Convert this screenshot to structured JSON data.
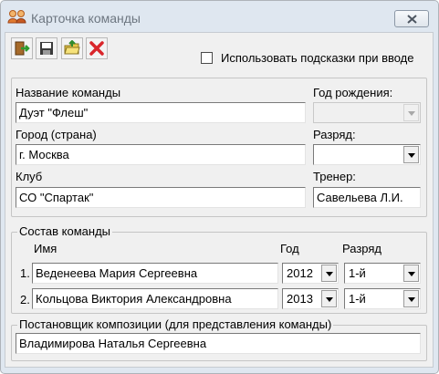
{
  "window": {
    "title": "Карточка команды"
  },
  "toolbar": {
    "buttons": [
      "exit-icon",
      "save-icon",
      "folder-icon",
      "delete-icon"
    ],
    "hint_checkbox_label": "Использовать подсказки при вводе",
    "hint_checked": false
  },
  "team": {
    "name_label": "Название команды",
    "name_value": "Дуэт \"Флеш\"",
    "birth_year_label": "Год рождения:",
    "birth_year_value": "",
    "city_label": "Город (страна)",
    "city_value": "г. Москва",
    "rank_label": "Разряд:",
    "rank_value": "",
    "club_label": "Клуб",
    "club_value": "СО \"Спартак\"",
    "coach_label": "Тренер:",
    "coach_value": "Савельева Л.И."
  },
  "members": {
    "group_title": "Состав команды",
    "col_name": "Имя",
    "col_year": "Год",
    "col_rank": "Разряд",
    "rows": [
      {
        "num": "1.",
        "name": "Веденеева Мария Сергеевна",
        "year": "2012",
        "rank": "1-й"
      },
      {
        "num": "2.",
        "name": "Кольцова Виктория Александровна",
        "year": "2013",
        "rank": "1-й"
      }
    ]
  },
  "choreographer": {
    "group_title": "Постановщик композиции (для представления команды)",
    "value": "Владимирова Наталья Сергеевна"
  },
  "colors": {
    "window_frame": "#dfe7f0",
    "client": "#f0f0f0",
    "delete": "#d9262b"
  }
}
